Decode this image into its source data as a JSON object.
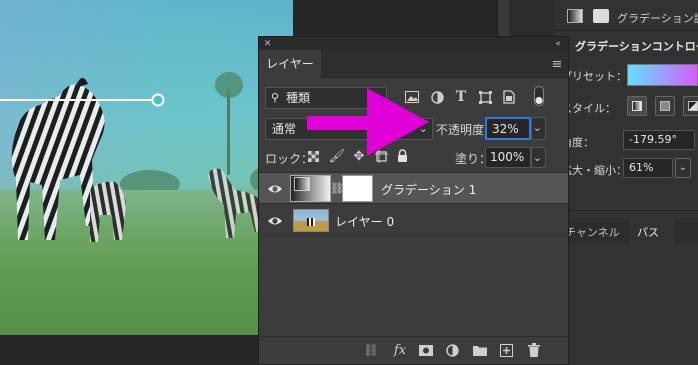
{
  "colors": {
    "accent_blue": "#2d7be0",
    "annotation_arrow": "#e000d8",
    "selected_row": "#555555"
  },
  "icons": [
    "close-icon",
    "collapse-icon",
    "panel-menu-icon",
    "search-icon",
    "image-filter-icon",
    "adjustment-filter-icon",
    "type-filter-icon",
    "shape-filter-icon",
    "smart-object-filter-icon",
    "filter-toggle-icon",
    "chevron-down-icon",
    "lock-pixels-icon",
    "lock-paint-icon",
    "lock-position-icon",
    "lock-artboard-icon",
    "lock-all-icon",
    "eye-icon",
    "link-icon",
    "fx-icon",
    "mask-icon",
    "adjustment-icon",
    "folder-icon",
    "new-layer-icon",
    "trash-icon"
  ],
  "layers_panel": {
    "tab": "レイヤー",
    "filter_kind": "種類",
    "blend_mode": "通常",
    "opacity_label": "不透明度：",
    "opacity_value": "32%",
    "lock_label": "ロック：",
    "fill_label": "塗り：",
    "fill_value": "100%",
    "layers": [
      {
        "name": "グラデーション 1",
        "selected": true
      },
      {
        "name": "レイヤー 0",
        "selected": false
      }
    ],
    "footer_fx": "fx"
  },
  "properties_panel": {
    "header": "グラデーション調",
    "section_title": "グラデーションコントロー",
    "preset_label": "プリセット：",
    "style_label": "スタイル：",
    "angle_label": "角度：",
    "angle_value": "-179.59°",
    "scale_label": "拡大・縮小：",
    "scale_value": "61%",
    "tabs": [
      "チャンネル",
      "パス"
    ]
  }
}
